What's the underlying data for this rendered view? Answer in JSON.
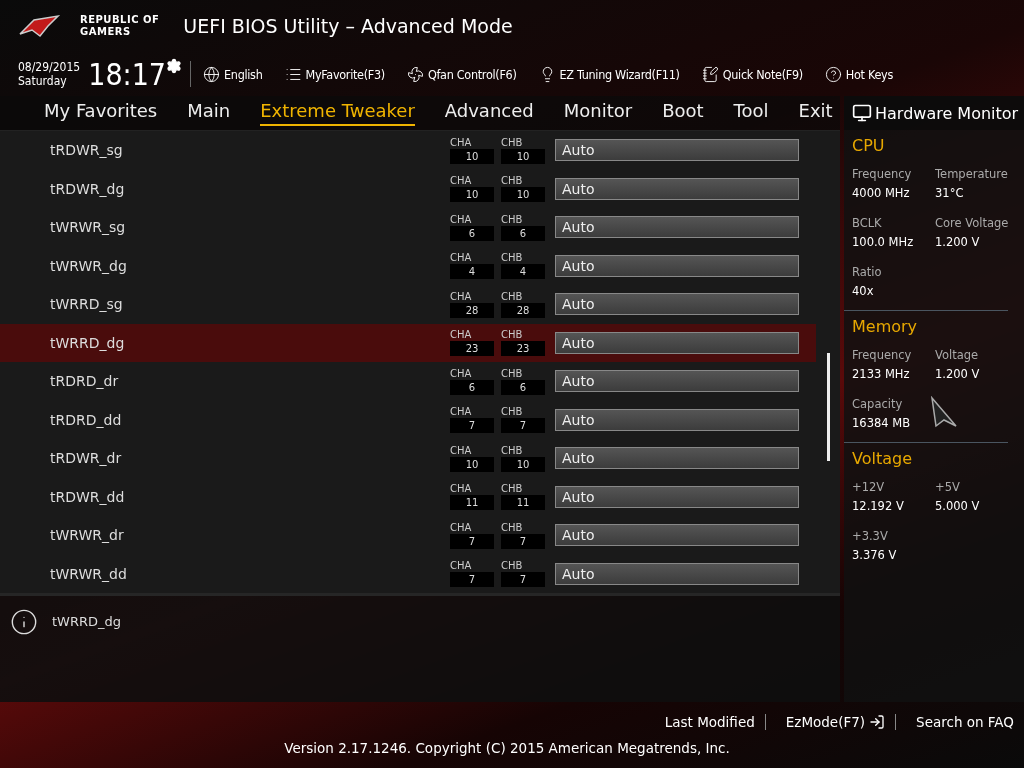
{
  "header": {
    "brand_line_1": "REPUBLIC OF",
    "brand_line_2": "GAMERS",
    "title": "UEFI BIOS Utility – Advanced Mode"
  },
  "toolbar": {
    "date": "08/29/2015",
    "day": "Saturday",
    "time": "18:17",
    "items": [
      {
        "kind": "globe",
        "label": "English"
      },
      {
        "kind": "favorite",
        "label": "MyFavorite(F3)"
      },
      {
        "kind": "fan",
        "label": "Qfan Control(F6)"
      },
      {
        "kind": "bulb",
        "label": "EZ Tuning Wizard(F11)"
      },
      {
        "kind": "note",
        "label": "Quick Note(F9)"
      },
      {
        "kind": "help",
        "label": "Hot Keys"
      }
    ]
  },
  "tabs": [
    {
      "label": "My Favorites",
      "selected": false
    },
    {
      "label": "Main",
      "selected": false
    },
    {
      "label": "Extreme Tweaker",
      "selected": true
    },
    {
      "label": "Advanced",
      "selected": false
    },
    {
      "label": "Monitor",
      "selected": false
    },
    {
      "label": "Boot",
      "selected": false
    },
    {
      "label": "Tool",
      "selected": false
    },
    {
      "label": "Exit",
      "selected": false
    }
  ],
  "settings": [
    {
      "name": "tRDWR_sg",
      "cha_label": "CHA",
      "cha": "10",
      "chb_label": "CHB",
      "chb": "10",
      "value": "Auto",
      "selected": false
    },
    {
      "name": "tRDWR_dg",
      "cha_label": "CHA",
      "cha": "10",
      "chb_label": "CHB",
      "chb": "10",
      "value": "Auto",
      "selected": false
    },
    {
      "name": "tWRWR_sg",
      "cha_label": "CHA",
      "cha": "6",
      "chb_label": "CHB",
      "chb": "6",
      "value": "Auto",
      "selected": false
    },
    {
      "name": "tWRWR_dg",
      "cha_label": "CHA",
      "cha": "4",
      "chb_label": "CHB",
      "chb": "4",
      "value": "Auto",
      "selected": false
    },
    {
      "name": "tWRRD_sg",
      "cha_label": "CHA",
      "cha": "28",
      "chb_label": "CHB",
      "chb": "28",
      "value": "Auto",
      "selected": false
    },
    {
      "name": "tWRRD_dg",
      "cha_label": "CHA",
      "cha": "23",
      "chb_label": "CHB",
      "chb": "23",
      "value": "Auto",
      "selected": true
    },
    {
      "name": "tRDRD_dr",
      "cha_label": "CHA",
      "cha": "6",
      "chb_label": "CHB",
      "chb": "6",
      "value": "Auto",
      "selected": false
    },
    {
      "name": "tRDRD_dd",
      "cha_label": "CHA",
      "cha": "7",
      "chb_label": "CHB",
      "chb": "7",
      "value": "Auto",
      "selected": false
    },
    {
      "name": "tRDWR_dr",
      "cha_label": "CHA",
      "cha": "10",
      "chb_label": "CHB",
      "chb": "10",
      "value": "Auto",
      "selected": false
    },
    {
      "name": "tRDWR_dd",
      "cha_label": "CHA",
      "cha": "11",
      "chb_label": "CHB",
      "chb": "11",
      "value": "Auto",
      "selected": false
    },
    {
      "name": "tWRWR_dr",
      "cha_label": "CHA",
      "cha": "7",
      "chb_label": "CHB",
      "chb": "7",
      "value": "Auto",
      "selected": false
    },
    {
      "name": "tWRWR_dd",
      "cha_label": "CHA",
      "cha": "7",
      "chb_label": "CHB",
      "chb": "7",
      "value": "Auto",
      "selected": false
    }
  ],
  "help_text": "tWRRD_dg",
  "hardware_monitor": {
    "title": "Hardware Monitor",
    "sections": [
      {
        "title": "CPU",
        "items": [
          {
            "label": "Frequency",
            "value": "4000 MHz"
          },
          {
            "label": "Temperature",
            "value": "31°C"
          },
          {
            "label": "BCLK",
            "value": "100.0 MHz"
          },
          {
            "label": "Core Voltage",
            "value": "1.200 V"
          },
          {
            "label": "Ratio",
            "value": "40x"
          }
        ]
      },
      {
        "title": "Memory",
        "items": [
          {
            "label": "Frequency",
            "value": "2133 MHz"
          },
          {
            "label": "Voltage",
            "value": "1.200 V"
          },
          {
            "label": "Capacity",
            "value": "16384 MB"
          }
        ]
      },
      {
        "title": "Voltage",
        "items": [
          {
            "label": "+12V",
            "value": "12.192 V"
          },
          {
            "label": "+5V",
            "value": "5.000 V"
          },
          {
            "label": "+3.3V",
            "value": "3.376 V"
          }
        ]
      }
    ]
  },
  "footer": {
    "links": [
      "Last Modified",
      "EzMode(F7)",
      "Search on FAQ"
    ],
    "version": "Version 2.17.1246. Copyright (C) 2015 American Megatrends, Inc."
  }
}
